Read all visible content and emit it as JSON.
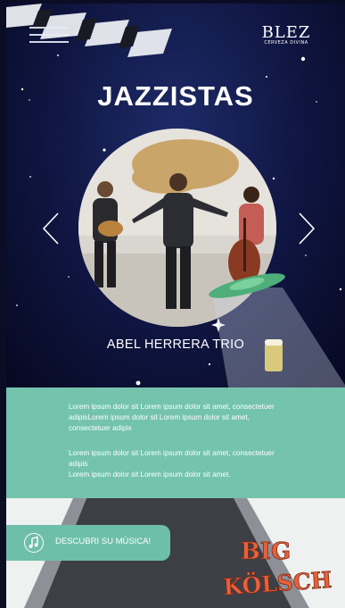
{
  "header": {
    "brand_name": "BLEZ",
    "brand_tagline": "CERVEZA DIVINA",
    "menu_icon": "hamburger-menu-icon"
  },
  "hero": {
    "title": "JAZZISTAS",
    "band_name": "ABEL HERRERA TRIO",
    "prev_icon": "chevron-left-icon",
    "next_icon": "chevron-right-icon"
  },
  "description": {
    "paragraph_1": "Lorem ipsum dolor sit Lorem ipsum dolor sit amet, consectetuer adipisLorem ipsum dolor sit Lorem ipsum dolor sit amet, consectetuer adipis",
    "paragraph_2": "Lorem ipsum dolor sit Lorem ipsum dolor sit amet, consectetuer adipis\nLorem ipsum dolor sit Lorem ipsum dolor sit amet."
  },
  "cta": {
    "label": "DESCUBRI SU MÚSICA!",
    "icon": "music-note-icon"
  },
  "footer_logo": {
    "line1": "BIG",
    "line2": "KÖLSCH"
  },
  "colors": {
    "night_sky": "#0f1540",
    "accent_teal": "#74c3ad",
    "logo_orange": "#e8603a"
  }
}
